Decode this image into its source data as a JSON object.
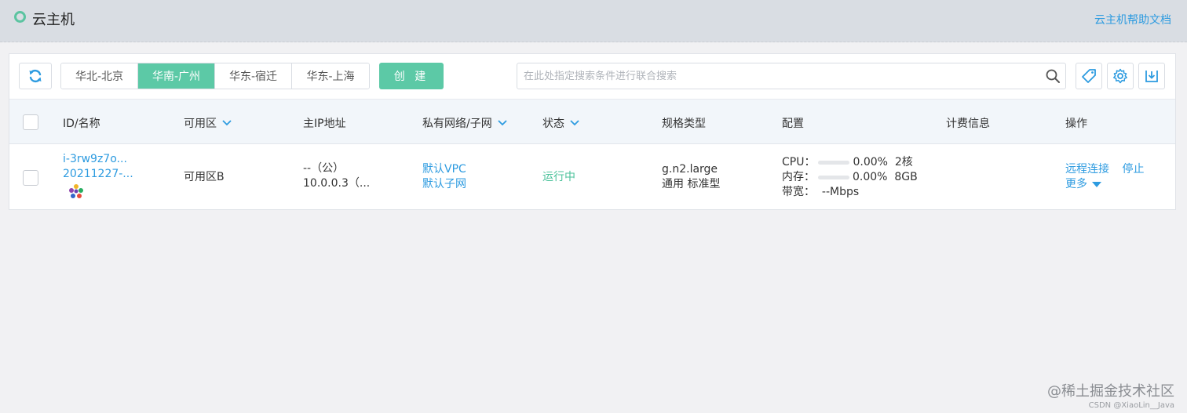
{
  "header": {
    "title": "云主机",
    "help_link": "云主机帮助文档"
  },
  "toolbar": {
    "regions": [
      {
        "label": "华北-北京",
        "active": false
      },
      {
        "label": "华南-广州",
        "active": true
      },
      {
        "label": "华东-宿迁",
        "active": false
      },
      {
        "label": "华东-上海",
        "active": false
      }
    ],
    "create_label": "创 建",
    "search_placeholder": "在此处指定搜索条件进行联合搜索",
    "icons": [
      "refresh-icon",
      "search-icon",
      "tag-icon",
      "gear-icon",
      "download-icon"
    ]
  },
  "table": {
    "columns": {
      "id_name": "ID/名称",
      "zone": "可用区",
      "main_ip": "主IP地址",
      "vpc": "私有网络/子网",
      "status": "状态",
      "spec": "规格类型",
      "config": "配置",
      "billing": "计费信息",
      "actions": "操作"
    },
    "rows": [
      {
        "id": "i-3rw9z7o...",
        "name": "20211227-...",
        "zone": "可用区B",
        "ip_public": "--（公）",
        "ip_private": "10.0.0.3（...",
        "vpc": "默认VPC",
        "subnet": "默认子网",
        "status": "运行中",
        "spec_name": "g.n2.large",
        "spec_type": "通用 标准型",
        "cpu_label": "CPU：",
        "cpu_usage": "0.00%",
        "cpu_cores": "2核",
        "mem_label": "内存：",
        "mem_usage": "0.00%",
        "mem_size": "8GB",
        "bw_label": "带宽：",
        "bw_value": "--Mbps",
        "action_remote": "远程连接",
        "action_stop": "停止",
        "action_more": "更多"
      }
    ]
  },
  "watermark": {
    "main": "@稀土掘金技术社区",
    "sub": "CSDN @XiaoLin__Java"
  },
  "colors": {
    "accent": "#5cc9a6",
    "link": "#2d9be0",
    "header_bg": "#d9dde3"
  }
}
